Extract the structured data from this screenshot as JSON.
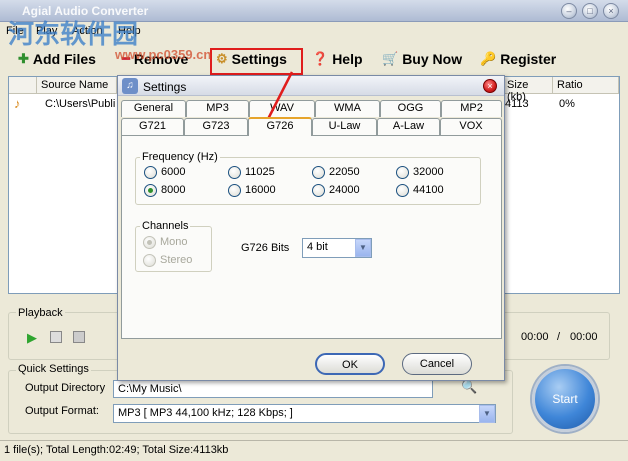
{
  "app": {
    "title": "Agial Audio Converter",
    "watermark": "河东软件园",
    "watermark_url": "www.pc0359.cn",
    "window_buttons": [
      "–",
      "□",
      "×"
    ]
  },
  "menu": [
    "File",
    "Play",
    "Action",
    "Help"
  ],
  "toolbar": {
    "add_files": "Add Files",
    "remove": "Remove",
    "settings": "Settings",
    "help": "Help",
    "buy_now": "Buy Now",
    "register": "Register"
  },
  "file_list": {
    "columns": [
      "Source Name",
      "Size (kb)",
      "Ratio"
    ],
    "rows": [
      {
        "source": "C:\\Users\\Publi",
        "size": "4113",
        "ratio": "0%"
      }
    ]
  },
  "playback": {
    "label": "Playback",
    "elapsed": "00:00",
    "separator": "/",
    "total": "00:00"
  },
  "quick_settings": {
    "label": "Quick Settings",
    "output_directory_label": "Output Directory",
    "output_directory_value": "C:\\My Music\\",
    "output_format_label": "Output Format:",
    "output_format_value": "MP3  [ MP3 44,100 kHz;  128 Kbps;  ]"
  },
  "start_button": "Start",
  "status": "1 file(s); Total Length:02:49; Total Size:4113kb",
  "settings_dialog": {
    "title": "Settings",
    "tabs_row1": [
      "General",
      "MP3",
      "WAV",
      "WMA",
      "OGG",
      "MP2"
    ],
    "tabs_row2": [
      "G721",
      "G723",
      "G726",
      "U-Law",
      "A-Law",
      "VOX"
    ],
    "active_tab": "G726",
    "frequency": {
      "label": "Frequency (Hz)",
      "options": [
        "6000",
        "11025",
        "22050",
        "32000",
        "8000",
        "16000",
        "24000",
        "44100"
      ],
      "selected": "8000"
    },
    "channels": {
      "label": "Channels",
      "options": [
        "Mono",
        "Stereo"
      ],
      "selected": "Mono"
    },
    "bits": {
      "label": "G726 Bits",
      "value": "4 bit"
    },
    "ok": "OK",
    "cancel": "Cancel"
  },
  "colors": {
    "annotation_red": "#e01d1d",
    "tab_active_accent": "#e6a42b",
    "radio_checked": "#2e8f2e"
  }
}
